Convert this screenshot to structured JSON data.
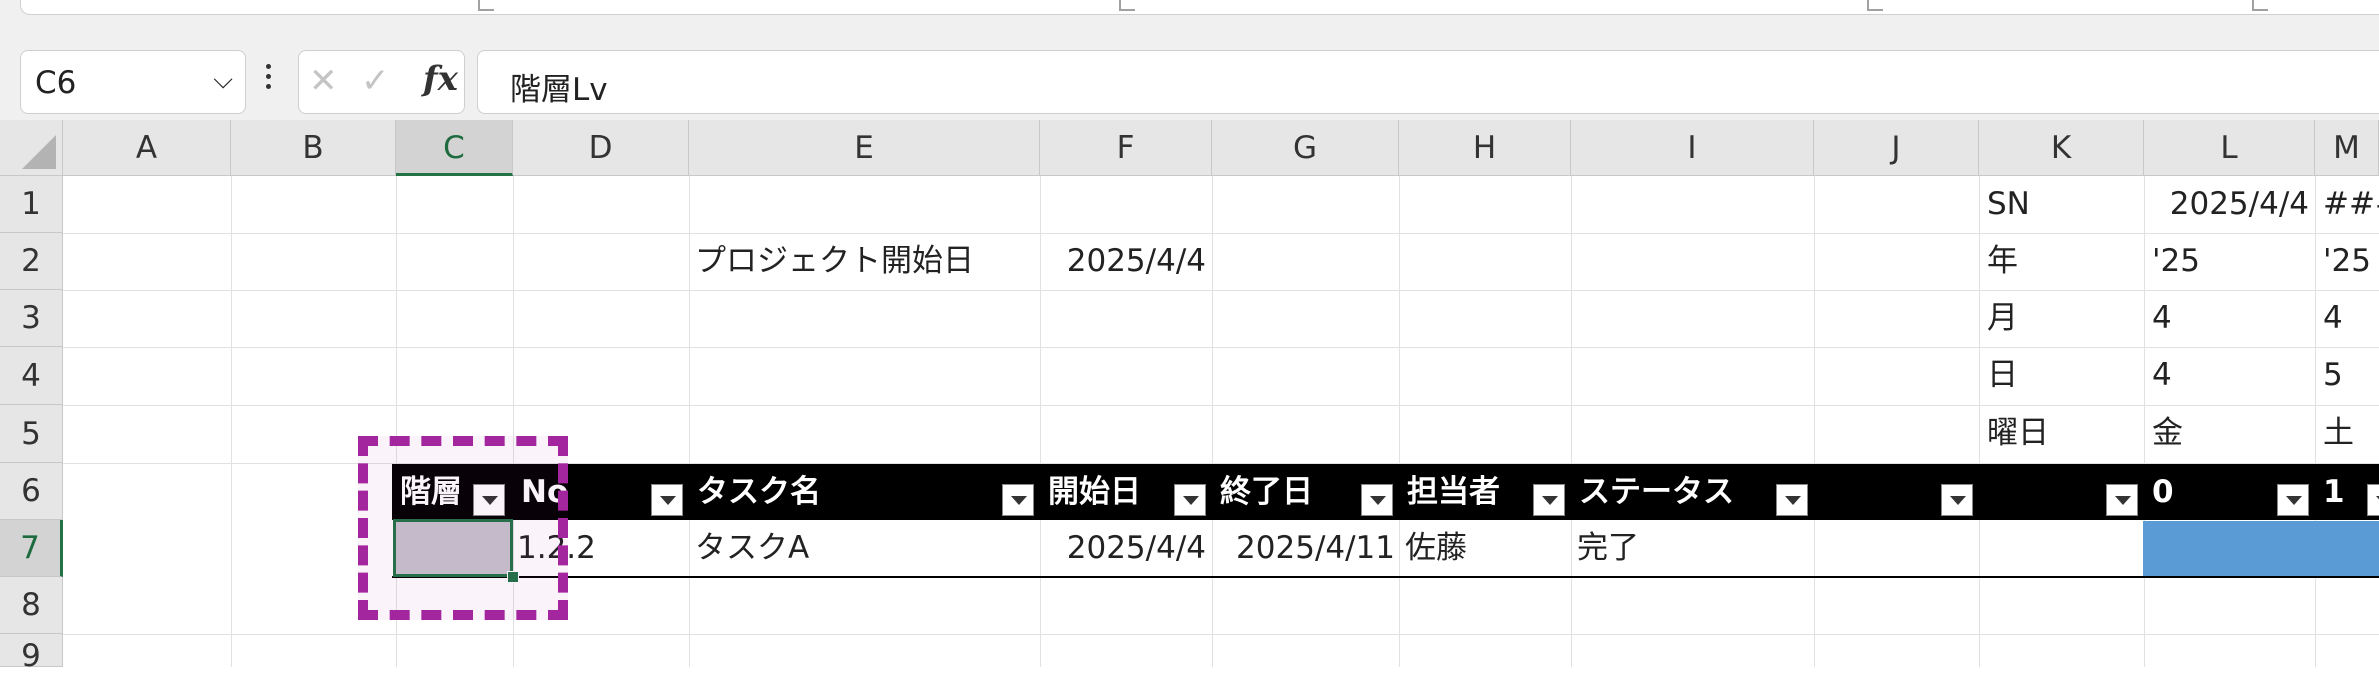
{
  "name_box": {
    "value": "C6"
  },
  "formula_bar": {
    "cancel_glyph": "✕",
    "enter_glyph": "✓",
    "fx_label": "fx",
    "formula": "階層Lv"
  },
  "columns": [
    "A",
    "B",
    "C",
    "D",
    "E",
    "F",
    "G",
    "H",
    "I",
    "J",
    "K",
    "L",
    "M"
  ],
  "selected_column": "C",
  "rows": [
    "1",
    "2",
    "3",
    "4",
    "5",
    "6",
    "7",
    "8",
    "9"
  ],
  "selected_row": "7",
  "cells": {
    "K1": "SN",
    "L1": "2025/4/4",
    "M1": "###",
    "E2": "プロジェクト開始日",
    "F2": "2025/4/4",
    "K2": "年",
    "L2": "'25",
    "M2": "'25",
    "K3": "月",
    "L3": "4",
    "M3": "4",
    "K4": "日",
    "L4": "4",
    "M4": "5",
    "K5": "曜日",
    "L5": "金",
    "M5": "土"
  },
  "table": {
    "headers": [
      "階層",
      "No",
      "タスク名",
      "開始日",
      "終了日",
      "担当者",
      "ステータス",
      "",
      "",
      "0",
      "1"
    ],
    "row": {
      "level": "",
      "no": "1.2.2",
      "task": "タスクA",
      "start": "2025/4/4",
      "end": "2025/4/11",
      "owner": "佐藤",
      "status": "完了"
    }
  },
  "highlight": {
    "color": "#a4269f"
  },
  "accent": {
    "selection": "#217346",
    "gantt_fill": "#5b9bd5"
  }
}
